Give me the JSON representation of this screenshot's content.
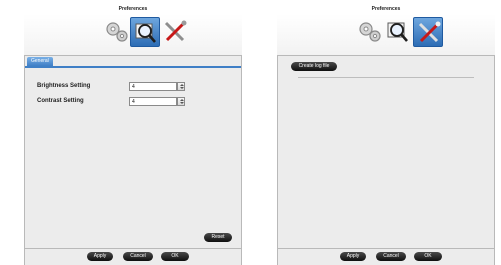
{
  "left_window": {
    "title": "Preferences",
    "toolbar": {
      "icons": [
        "gears-icon",
        "magnifier-icon",
        "tools-icon"
      ],
      "selected": "magnifier-icon"
    },
    "tab": {
      "label": "General"
    },
    "settings": [
      {
        "label": "Brightness Setting",
        "value": "4"
      },
      {
        "label": "Contrast Setting",
        "value": "4"
      }
    ],
    "reset_label": "Reset",
    "buttons": {
      "apply": "Apply",
      "cancel": "Cancel",
      "ok": "OK"
    }
  },
  "right_window": {
    "title": "Preferences",
    "toolbar": {
      "icons": [
        "gears-icon",
        "magnifier-icon",
        "tools-icon"
      ],
      "selected": "tools-icon"
    },
    "create_log_label": "Create log file",
    "buttons": {
      "apply": "Apply",
      "cancel": "Cancel",
      "ok": "OK"
    }
  },
  "colors": {
    "accent": "#3f7fc6",
    "selected_tool": "#2d6db5",
    "button_dark": "#111111",
    "panel_bg": "#ececec"
  }
}
